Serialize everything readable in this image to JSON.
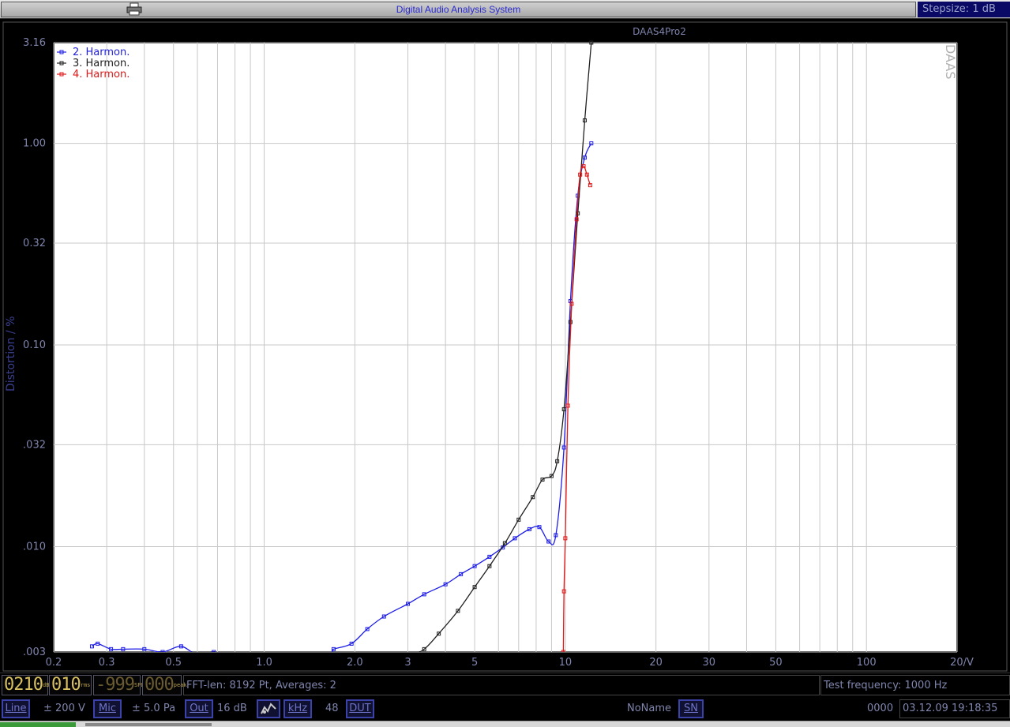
{
  "window": {
    "title": "Digital Audio Analysis System",
    "stepsize": "Stepsize: 1 dB",
    "printer_icon": "printer-icon"
  },
  "chart_data": {
    "type": "line",
    "title": "DAAS4Pro2",
    "watermark": "DAAS",
    "xlabel": "",
    "ylabel": "Distortion / %",
    "x_unit": "V",
    "x_scale": "log",
    "y_scale": "log",
    "xlim": [
      0.2,
      20
    ],
    "ylim": [
      0.003,
      3.16
    ],
    "x_ticks": [
      {
        "v": 0.2,
        "label": "0.2"
      },
      {
        "v": 0.3,
        "label": "0.3"
      },
      {
        "v": 0.5,
        "label": "0.5"
      },
      {
        "v": 1,
        "label": "1.0"
      },
      {
        "v": 2,
        "label": "2.0"
      },
      {
        "v": 3,
        "label": "3"
      },
      {
        "v": 5,
        "label": "5"
      },
      {
        "v": 10,
        "label": "10"
      },
      {
        "v": 20,
        "label": "20"
      },
      {
        "v": 30,
        "label": "30"
      },
      {
        "v": 50,
        "label": "50"
      },
      {
        "v": 100,
        "label": "100"
      },
      {
        "v": 200,
        "label": "20/V"
      }
    ],
    "y_ticks": [
      {
        "v": 3.16,
        "label": "3.16"
      },
      {
        "v": 1.0,
        "label": "1.00"
      },
      {
        "v": 0.32,
        "label": "0.32"
      },
      {
        "v": 0.1,
        "label": "0.10"
      },
      {
        "v": 0.032,
        "label": ".032"
      },
      {
        "v": 0.01,
        "label": ".010"
      },
      {
        "v": 0.003,
        "label": ".003"
      }
    ],
    "grid": true,
    "legend_position": "top-left",
    "series": [
      {
        "name": "2. Harmon.",
        "color": "#1e1ee6",
        "x": [
          0.268,
          0.28,
          0.31,
          0.34,
          0.4,
          0.46,
          0.53,
          0.6,
          0.68,
          0.75,
          1.55,
          1.7,
          1.95,
          2.2,
          2.5,
          3.0,
          3.4,
          4.0,
          4.5,
          5.0,
          5.6,
          6.2,
          6.8,
          7.6,
          8.2,
          8.8,
          9.3,
          9.9,
          10.4,
          11.0,
          11.6,
          12.2
        ],
        "y": [
          0.0032,
          0.0033,
          0.0031,
          0.0031,
          0.0031,
          0.003,
          0.0032,
          0.0029,
          0.003,
          0.0029,
          0.0029,
          0.0031,
          0.0033,
          0.0039,
          0.0045,
          0.0052,
          0.0058,
          0.0065,
          0.0073,
          0.008,
          0.0089,
          0.0099,
          0.011,
          0.0122,
          0.0125,
          0.0106,
          0.0114,
          0.031,
          0.165,
          0.55,
          0.85,
          1.0
        ]
      },
      {
        "name": "3. Harmon.",
        "color": "#202020",
        "x": [
          3.0,
          3.4,
          3.8,
          4.4,
          5.0,
          5.6,
          6.3,
          7.0,
          7.8,
          8.4,
          9.0,
          9.4,
          9.9,
          10.4,
          11.0,
          11.6,
          12.2
        ],
        "y": [
          0.0028,
          0.0031,
          0.0037,
          0.0048,
          0.0063,
          0.008,
          0.0104,
          0.0136,
          0.0176,
          0.0215,
          0.0224,
          0.0265,
          0.048,
          0.13,
          0.45,
          1.3,
          3.16
        ]
      },
      {
        "name": "4. Harmon.",
        "color": "#e01818",
        "x": [
          9.85,
          9.9,
          10.0,
          10.2,
          10.5,
          10.9,
          11.2,
          11.5,
          11.8,
          12.1
        ],
        "y": [
          0.003,
          0.006,
          0.011,
          0.05,
          0.16,
          0.42,
          0.7,
          0.77,
          0.7,
          0.62
        ]
      }
    ]
  },
  "status": {
    "lcd1": {
      "value": "0210",
      "unit": "dBV"
    },
    "lcd2": {
      "value": "010",
      "unit": "rms"
    },
    "lcd3": {
      "value": "-999",
      "unit": "SPL"
    },
    "lcd4": {
      "value": "000",
      "unit": "peak"
    },
    "fft_info": "FFT-len: 8192 Pt, Averages: 2",
    "test_frequency": "Test frequency: 1000 Hz"
  },
  "controls": {
    "line_button": "Line",
    "line_value": "± 200 V",
    "mic_button": "Mic",
    "mic_value": "± 5.0 Pa",
    "out_button": "Out",
    "out_value": "16 dB",
    "sweep_icon": "sweep-icon",
    "khz_button": "kHz",
    "khz_value": "48",
    "dut_button": "DUT",
    "name_value": "NoName",
    "sn_button": "SN",
    "serial_value": "0000",
    "datetime": "03.12.09 19:18:35"
  }
}
